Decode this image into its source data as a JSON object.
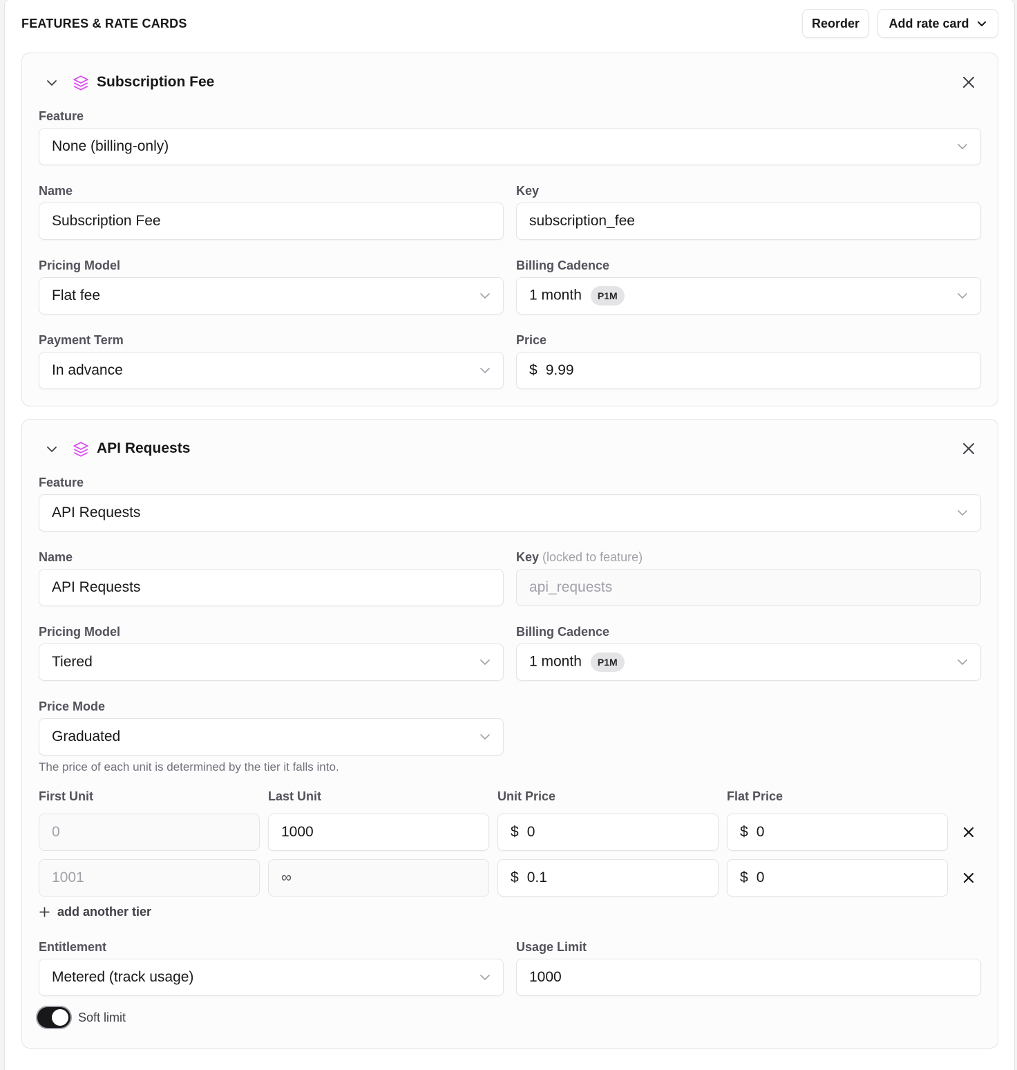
{
  "header": {
    "title": "FEATURES & RATE CARDS",
    "reorder_label": "Reorder",
    "add_rate_card_label": "Add rate card"
  },
  "cards": [
    {
      "title": "Subscription Fee",
      "feature_label": "Feature",
      "feature_value": "None (billing-only)",
      "name_label": "Name",
      "name_value": "Subscription Fee",
      "key_label": "Key",
      "key_value": "subscription_fee",
      "pricing_model_label": "Pricing Model",
      "pricing_model_value": "Flat fee",
      "billing_cadence_label": "Billing Cadence",
      "billing_cadence_value": "1 month",
      "billing_cadence_badge": "P1M",
      "payment_term_label": "Payment Term",
      "payment_term_value": "In advance",
      "price_label": "Price",
      "price_currency": "$",
      "price_value": "9.99"
    },
    {
      "title": "API Requests",
      "feature_label": "Feature",
      "feature_value": "API Requests",
      "name_label": "Name",
      "name_value": "API Requests",
      "key_label": "Key",
      "key_label_suffix": "(locked to feature)",
      "key_value": "api_requests",
      "pricing_model_label": "Pricing Model",
      "pricing_model_value": "Tiered",
      "billing_cadence_label": "Billing Cadence",
      "billing_cadence_value": "1 month",
      "billing_cadence_badge": "P1M",
      "price_mode_label": "Price Mode",
      "price_mode_value": "Graduated",
      "price_mode_help": "The price of each unit is determined by the tier it falls into.",
      "tier_headers": {
        "first_unit": "First Unit",
        "last_unit": "Last Unit",
        "unit_price": "Unit Price",
        "flat_price": "Flat Price"
      },
      "tiers": [
        {
          "first_unit": "0",
          "last_unit": "1000",
          "unit_price": "0",
          "flat_price": "0"
        },
        {
          "first_unit": "1001",
          "last_unit": "∞",
          "unit_price": "0.1",
          "flat_price": "0"
        }
      ],
      "currency": "$",
      "add_tier_label": "add another tier",
      "entitlement_label": "Entitlement",
      "entitlement_value": "Metered (track usage)",
      "usage_limit_label": "Usage Limit",
      "usage_limit_value": "1000",
      "soft_limit_label": "Soft limit",
      "soft_limit_on": true
    }
  ],
  "colors": {
    "accent_icon": "#d946ef",
    "toggle_on": "#18181b"
  },
  "icons": {
    "collapse": "chevron-down-icon",
    "feature": "layers-icon",
    "remove": "close-icon",
    "add": "plus-icon",
    "dropdown": "chevron-down-icon"
  }
}
